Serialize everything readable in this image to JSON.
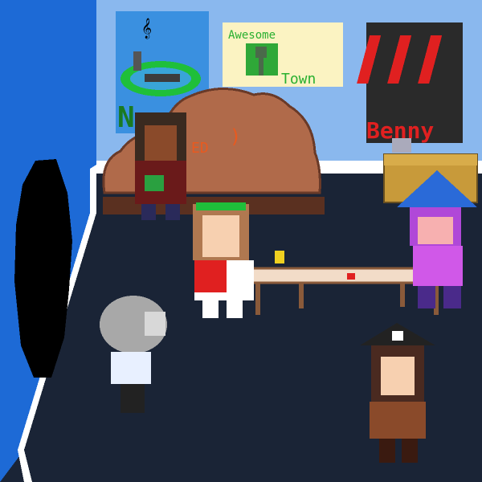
{
  "scene": {
    "posters": {
      "left": {
        "label": "N"
      },
      "middle": {
        "title": "Awesome",
        "subtitle": "Town"
      },
      "right": {
        "label": "Benny"
      }
    },
    "couch_text": "ED"
  },
  "colors": {
    "wall": "#8ab8ee",
    "wall_side": "#1d6ad6",
    "floor": "#1a2436",
    "trim": "#ffffff",
    "couch": "#b06a4a",
    "table": "#f2dcc8",
    "poster_red": "#e02020"
  },
  "characters": [
    {
      "name": "dark-haired-kid",
      "icon": "kid-sprite"
    },
    {
      "name": "flower-crown-kid",
      "icon": "kid-sprite"
    },
    {
      "name": "football-helmet-kid",
      "icon": "helmet-sprite"
    },
    {
      "name": "wizard-hat-kid",
      "icon": "wizard-sprite"
    },
    {
      "name": "pirate-kid",
      "icon": "pirate-sprite"
    }
  ]
}
